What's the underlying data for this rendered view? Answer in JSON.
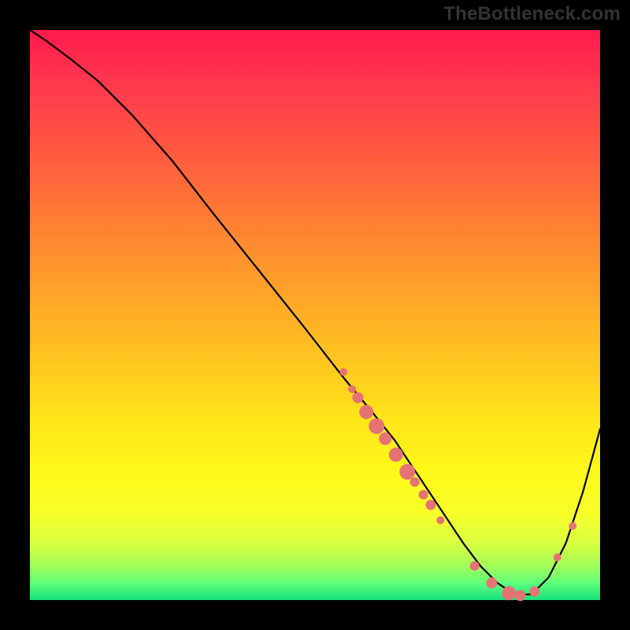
{
  "watermark": "TheBottleneck.com",
  "colors": {
    "curve_stroke": "#000000",
    "dot_fill": "#e57373",
    "gradient_top": "#ff1a4d",
    "gradient_bottom": "#14e27d"
  },
  "chart_data": {
    "type": "line",
    "title": "",
    "xlabel": "",
    "ylabel": "",
    "xlim": [
      0,
      100
    ],
    "ylim": [
      0,
      100
    ],
    "grid": false,
    "series": [
      {
        "name": "bottleneck-curve",
        "x": [
          0,
          3,
          7,
          12,
          18,
          25,
          32,
          40,
          48,
          55,
          60,
          64,
          68,
          72,
          76,
          79,
          82,
          85,
          88,
          91,
          94,
          97,
          100
        ],
        "y": [
          100,
          98,
          95,
          91,
          85,
          77,
          68,
          58,
          48,
          39,
          33,
          28,
          22,
          16,
          10,
          6,
          3,
          1,
          1,
          4,
          10,
          19,
          30
        ]
      }
    ],
    "dots": [
      {
        "x": 55,
        "y": 40,
        "r": 5
      },
      {
        "x": 56.5,
        "y": 37,
        "r": 5
      },
      {
        "x": 57.5,
        "y": 35.5,
        "r": 7
      },
      {
        "x": 59,
        "y": 33,
        "r": 9
      },
      {
        "x": 60.8,
        "y": 30.5,
        "r": 10
      },
      {
        "x": 62.3,
        "y": 28.3,
        "r": 8
      },
      {
        "x": 64.2,
        "y": 25.5,
        "r": 9
      },
      {
        "x": 66.2,
        "y": 22.5,
        "r": 10
      },
      {
        "x": 67.5,
        "y": 20.7,
        "r": 6
      },
      {
        "x": 69,
        "y": 18.5,
        "r": 6
      },
      {
        "x": 70.3,
        "y": 16.7,
        "r": 6.5
      },
      {
        "x": 72,
        "y": 14,
        "r": 5
      },
      {
        "x": 78,
        "y": 6,
        "r": 6
      },
      {
        "x": 81,
        "y": 3,
        "r": 7
      },
      {
        "x": 84,
        "y": 1.2,
        "r": 9
      },
      {
        "x": 86,
        "y": 0.8,
        "r": 7
      },
      {
        "x": 88.5,
        "y": 1.5,
        "r": 6.5
      },
      {
        "x": 92.5,
        "y": 7.5,
        "r": 5
      },
      {
        "x": 95.2,
        "y": 13,
        "r": 5
      }
    ],
    "note": "Values estimated from unlabeled plot; x and y normalized to 0-100. y=0 is the bottom (green band). Curve descends from top-left, reaches minimum near x≈86, then rises."
  }
}
